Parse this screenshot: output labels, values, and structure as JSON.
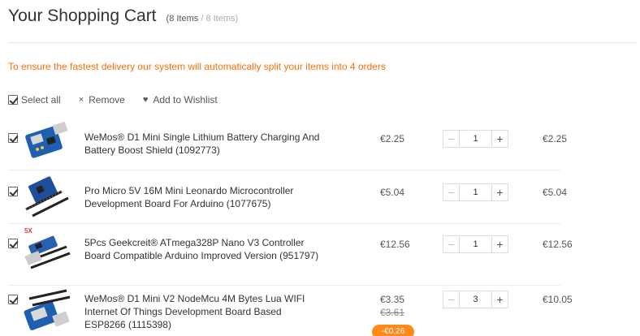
{
  "header": {
    "title": "Your Shopping Cart",
    "count_open": "(8 Items",
    "count_sep": " / ",
    "count_total": "8 Items)"
  },
  "notice": "To ensure the fastest delivery our system will automatically split your items into 4 orders",
  "actions": {
    "select_all": "Select all",
    "remove": "Remove",
    "wishlist": "Add to Wishlist"
  },
  "items": [
    {
      "name": "WeMos® D1 Mini Single Lithium Battery Charging And Battery Boost Shield (1092773)",
      "price": "€2.25",
      "qty": "1",
      "subtotal": "€2.25",
      "checked": true
    },
    {
      "name": "Pro Micro 5V 16M Mini Leonardo Microcontroller Development Board For Arduino (1077675)",
      "price": "€5.04",
      "qty": "1",
      "subtotal": "€5.04",
      "checked": true
    },
    {
      "name": "5Pcs Geekcreit® ATmega328P Nano V3 Controller Board Compatible Arduino Improved Version (951797)",
      "price": "€12.56",
      "qty": "1",
      "subtotal": "€12.56",
      "checked": true,
      "badge": "5X"
    },
    {
      "name": "WeMos® D1 Mini V2 NodeMcu 4M Bytes Lua WIFI Internet Of Things Development Board Based ESP8266 (1115398)",
      "price": "€3.35",
      "old_price": "€3.61",
      "qty": "3",
      "subtotal": "€10.05",
      "checked": true,
      "promo": "-€0.26"
    }
  ],
  "colors": {
    "accent": "#ff6e0d",
    "promo": "#ff8a1a",
    "text": "#333333",
    "muted": "#aaaaaa"
  },
  "icons": {
    "remove": "close-icon",
    "wishlist": "heart-icon",
    "minus": "minus-icon",
    "plus": "plus-icon"
  }
}
